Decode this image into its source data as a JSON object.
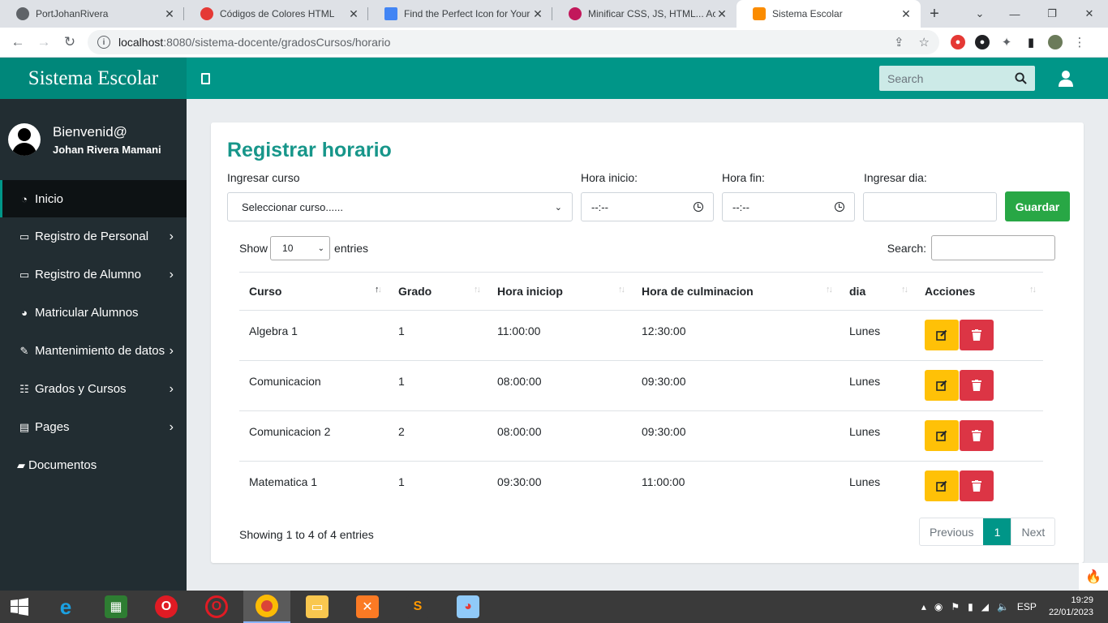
{
  "browser": {
    "tabs": [
      {
        "title": "PortJohanRivera",
        "favicon_color": "#5f6368",
        "close": "✕"
      },
      {
        "title": "Códigos de Colores HTML",
        "favicon_color": "#e53935",
        "close": "✕"
      },
      {
        "title": "Find the Perfect Icon for Your P",
        "favicon_color": "#4285f4",
        "close": "✕"
      },
      {
        "title": "Minificar CSS, JS, HTML... Acele",
        "favicon_color": "#c2185b",
        "close": "✕"
      },
      {
        "title": "Sistema Escolar",
        "favicon_color": "#fb8c00",
        "close": "✕"
      }
    ],
    "url_host": "localhost",
    "url_path": ":8080/sistema-docente/gradosCursos/horario"
  },
  "app": {
    "brand": "Sistema Escolar",
    "search_placeholder": "Search"
  },
  "sidebar": {
    "greeting": "Bienvenid@",
    "user_name": "Johan Rivera Mamani",
    "items": [
      {
        "label": "Inicio",
        "icon": "dashboard-icon",
        "has_children": false
      },
      {
        "label": "Registro de Personal",
        "icon": "laptop-icon",
        "has_children": true
      },
      {
        "label": "Registro de Alumno",
        "icon": "laptop-icon",
        "has_children": true
      },
      {
        "label": "Matricular Alumnos",
        "icon": "pie-chart-icon",
        "has_children": false
      },
      {
        "label": "Mantenimiento de datos",
        "icon": "edit-icon",
        "has_children": true
      },
      {
        "label": "Grados y Cursos",
        "icon": "table-icon",
        "has_children": true
      },
      {
        "label": "Pages",
        "icon": "file-icon",
        "has_children": true
      },
      {
        "label": "Documentos",
        "icon": "folder-icon",
        "has_children": false
      }
    ]
  },
  "form": {
    "title": "Registrar horario",
    "course_label": "Ingresar curso",
    "course_value": "Seleccionar curso......",
    "start_label": "Hora inicio:",
    "start_value": "--:--",
    "end_label": "Hora fin:",
    "end_value": "--:--",
    "day_label": "Ingresar dia:",
    "day_value": "",
    "save_label": "Guardar"
  },
  "table": {
    "show_label": "Show",
    "entries_value": "10",
    "entries_label": "entries",
    "search_label": "Search:",
    "columns": [
      "Curso",
      "Grado",
      "Hora iniciop",
      "Hora de culminacion",
      "dia",
      "Acciones"
    ],
    "rows": [
      {
        "curso": "Algebra 1",
        "grado": "1",
        "inicio": "11:00:00",
        "fin": "12:30:00",
        "dia": "Lunes"
      },
      {
        "curso": "Comunicacion",
        "grado": "1",
        "inicio": "08:00:00",
        "fin": "09:30:00",
        "dia": "Lunes"
      },
      {
        "curso": "Comunicacion 2",
        "grado": "2",
        "inicio": "08:00:00",
        "fin": "09:30:00",
        "dia": "Lunes"
      },
      {
        "curso": "Matematica 1",
        "grado": "1",
        "inicio": "09:30:00",
        "fin": "11:00:00",
        "dia": "Lunes"
      }
    ],
    "info": "Showing 1 to 4 of 4 entries",
    "pagination": {
      "previous": "Previous",
      "current": "1",
      "next": "Next"
    }
  },
  "taskbar": {
    "language": "ESP",
    "time": "19:29",
    "date": "22/01/2023"
  },
  "colors": {
    "primary": "#009688",
    "sidebar": "#222d32",
    "save": "#28a745",
    "edit": "#ffc107",
    "delete": "#dc3545"
  }
}
